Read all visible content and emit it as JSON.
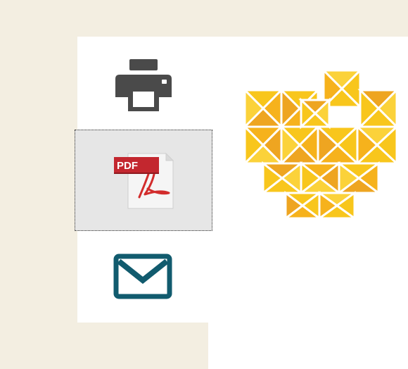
{
  "toolbar": {
    "buttons": [
      {
        "id": "print",
        "icon": "printer-icon"
      },
      {
        "id": "pdf",
        "icon": "pdf-document-icon",
        "badge_text": "PDF",
        "focused": true
      },
      {
        "id": "email",
        "icon": "envelope-icon"
      }
    ]
  },
  "logo": {
    "icon": "heart-logo-icon"
  },
  "colors": {
    "background": "#f3eee1",
    "panel": "#ffffff",
    "focus_bg": "#e6e6e6",
    "printer": "#4a4a4a",
    "pdf_badge": "#c3272f",
    "pdf_symbol": "#d22c2c",
    "email": "#115b6e",
    "heart_yellow": "#f8c61c",
    "heart_orange": "#eea521"
  }
}
